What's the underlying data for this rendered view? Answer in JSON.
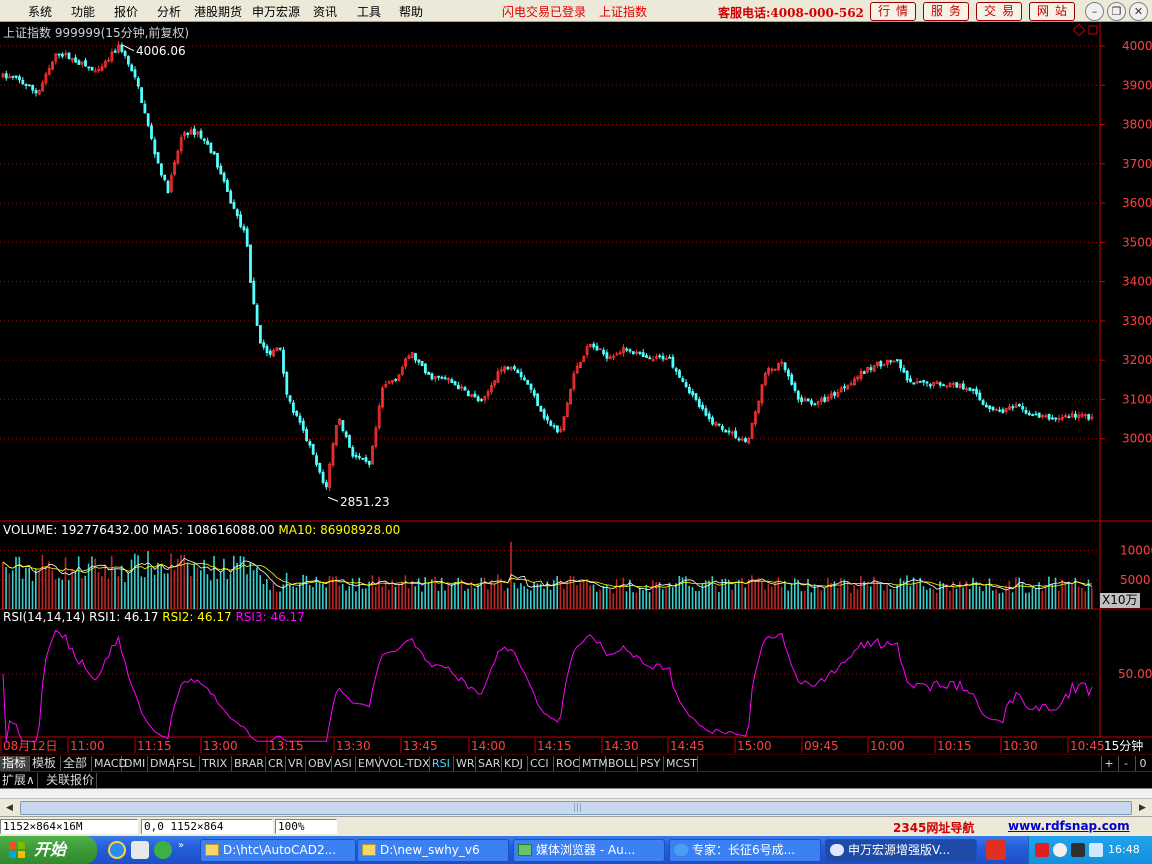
{
  "menubar": {
    "items": [
      "系统",
      "功能",
      "报价",
      "分析",
      "港股期货",
      "申万宏源",
      "资讯",
      "工具",
      "帮助"
    ],
    "notice_login": "闪电交易已登录",
    "notice_index": "上证指数",
    "hotline": "客服电话:4008-000-562",
    "buttons": [
      "行情",
      "服务",
      "交易",
      "网站"
    ],
    "window_controls": [
      "minimize-icon",
      "restore-icon",
      "close-icon"
    ]
  },
  "main_chart": {
    "title": "上证指数 999999(15分钟,前复权)",
    "high_label": "4006.06",
    "low_label": "2851.23",
    "price_ticks": [
      "4000",
      "3900",
      "3800",
      "3700",
      "3600",
      "3500",
      "3400",
      "3300",
      "3200",
      "3100",
      "3000"
    ]
  },
  "volume_panel": {
    "volume": "VOLUME: 192776432.00",
    "ma5": "MA5: 108616088.00",
    "ma10": "MA10: 86908928.00",
    "ticks": [
      "10000",
      "5000"
    ],
    "unit": "X10万"
  },
  "rsi_panel": {
    "params": "RSI(14,14,14)",
    "rsi1": "RSI1: 46.17",
    "rsi2": "RSI2: 46.17",
    "rsi3": "RSI3: 46.17",
    "tick": "50.00"
  },
  "time_axis": {
    "labels": [
      "08月12日",
      "11:00",
      "11:15",
      "13:00",
      "13:15",
      "13:30",
      "13:45",
      "14:00",
      "14:15",
      "14:30",
      "14:45",
      "15:00",
      "09:45",
      "10:00",
      "10:15",
      "10:30",
      "10:45"
    ],
    "period": "15分钟"
  },
  "indicator_tabs": [
    "指标",
    "模板",
    "全部",
    "MACD",
    "DMI",
    "DMA",
    "FSL",
    "TRIX",
    "BRAR",
    "CR",
    "VR",
    "OBV",
    "ASI",
    "EMV",
    "VOL-TDX",
    "RSI",
    "WR",
    "SAR",
    "KDJ",
    "CCI",
    "ROC",
    "MTM",
    "BOLL",
    "PSY",
    "MCST"
  ],
  "active_indicator": "RSI",
  "tab_controls": [
    "+",
    "-",
    "0"
  ],
  "sub_tabs": [
    "扩展∧",
    "关联报价"
  ],
  "statusbar": {
    "size": "1152×864×16M",
    "coords": "0,0 1152×864",
    "zoom": "100%",
    "nav": "2345网址导航",
    "site": "www.rdfsnap.com"
  },
  "taskbar": {
    "start": "开始",
    "tasks": [
      "D:\\htc\\AutoCAD2...",
      "D:\\new_swhy_v6",
      "媒体浏览器 - Au...",
      "专家：长征6号成...",
      "申万宏源增强版V..."
    ],
    "clock": "16:48"
  },
  "colors": {
    "up": "#ff3232",
    "down": "#54ffff",
    "grid": "#a00000",
    "axis": "#c00000",
    "ma5": "#ffffff",
    "ma10": "#ffff00",
    "rsi": "#ff00ff"
  }
}
